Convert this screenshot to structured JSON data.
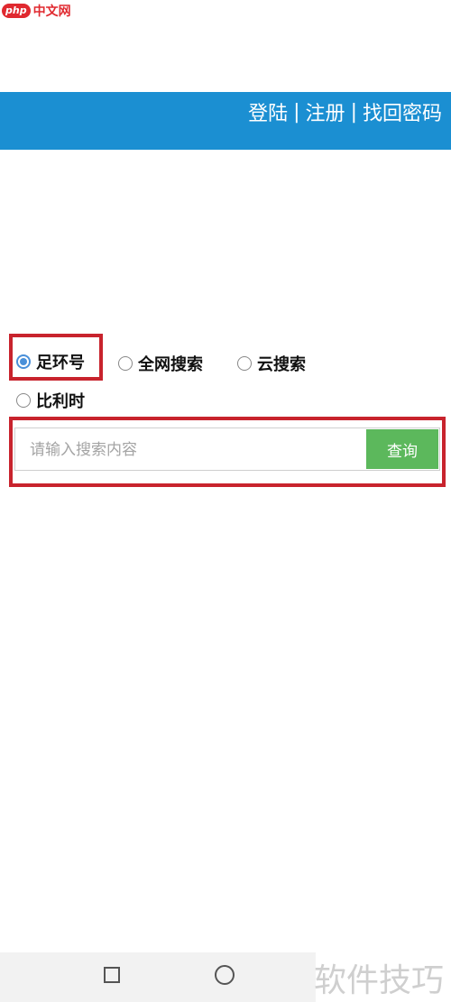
{
  "watermark": {
    "logo_badge": "php",
    "logo_text": "中文网",
    "bottom_text": "软件技巧"
  },
  "header": {
    "login": "登陆",
    "separator": "|",
    "register": "注册",
    "recover": "找回密码",
    "bg_color": "#1b8fd2"
  },
  "options": [
    {
      "label": "足环号",
      "selected": true
    },
    {
      "label": "全网搜索",
      "selected": false
    },
    {
      "label": "云搜索",
      "selected": false
    },
    {
      "label": "比利时",
      "selected": false
    }
  ],
  "search": {
    "placeholder": "请输入搜索内容",
    "button_label": "查询",
    "button_color": "#5cb85c"
  },
  "highlight_color": "#c8232d",
  "navbar": {
    "icons": [
      "recent-apps-icon",
      "home-icon"
    ]
  }
}
